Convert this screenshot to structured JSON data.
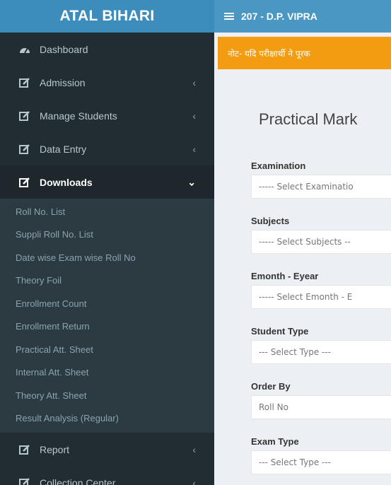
{
  "brand": {
    "title": "ATAL BIHARI"
  },
  "topbar": {
    "title": "207 - D.P. VIPRA"
  },
  "sidebar": {
    "items": [
      {
        "label": "Dashboard",
        "icon": "dashboard-icon",
        "chevron": ""
      },
      {
        "label": "Admission",
        "icon": "edit-icon",
        "chevron": "‹"
      },
      {
        "label": "Manage Students",
        "icon": "edit-icon",
        "chevron": "‹"
      },
      {
        "label": "Data Entry",
        "icon": "edit-icon",
        "chevron": "‹"
      },
      {
        "label": "Downloads",
        "icon": "edit-icon",
        "chevron": "⌄"
      },
      {
        "label": "Report",
        "icon": "edit-icon",
        "chevron": "‹"
      },
      {
        "label": "Collection Center",
        "icon": "edit-icon",
        "chevron": "‹"
      }
    ],
    "downloads_submenu": [
      "Roll No. List",
      "Suppli Roll No. List",
      "Date wise Exam wise Roll No",
      "Theory Foil",
      "Enrollment Count",
      "Enrollment Return",
      "Practical Att. Sheet",
      "Internal Att. Sheet",
      "Theory Att. Sheet",
      "Result Analysis (Regular)"
    ]
  },
  "main": {
    "notice": "नोट- यदि परीक्षार्थी ने पूरक",
    "page_title": "Practical Mark",
    "fields": [
      {
        "label": "Examination",
        "value": "----- Select Examinatio"
      },
      {
        "label": "Subjects",
        "value": "----- Select Subjects --"
      },
      {
        "label": "Emonth - Eyear",
        "value": "----- Select Emonth - E"
      },
      {
        "label": "Student Type",
        "value": "--- Select Type ---"
      },
      {
        "label": "Order By",
        "value": "Roll No"
      },
      {
        "label": "Exam Type",
        "value": "--- Select Type ---"
      }
    ]
  },
  "colors": {
    "brand_bg": "#3c8dbc",
    "sidebar_bg": "#222d32",
    "submenu_bg": "#2c3b41",
    "notice_bg": "#f39c12",
    "content_bg": "#ecf0f5"
  }
}
